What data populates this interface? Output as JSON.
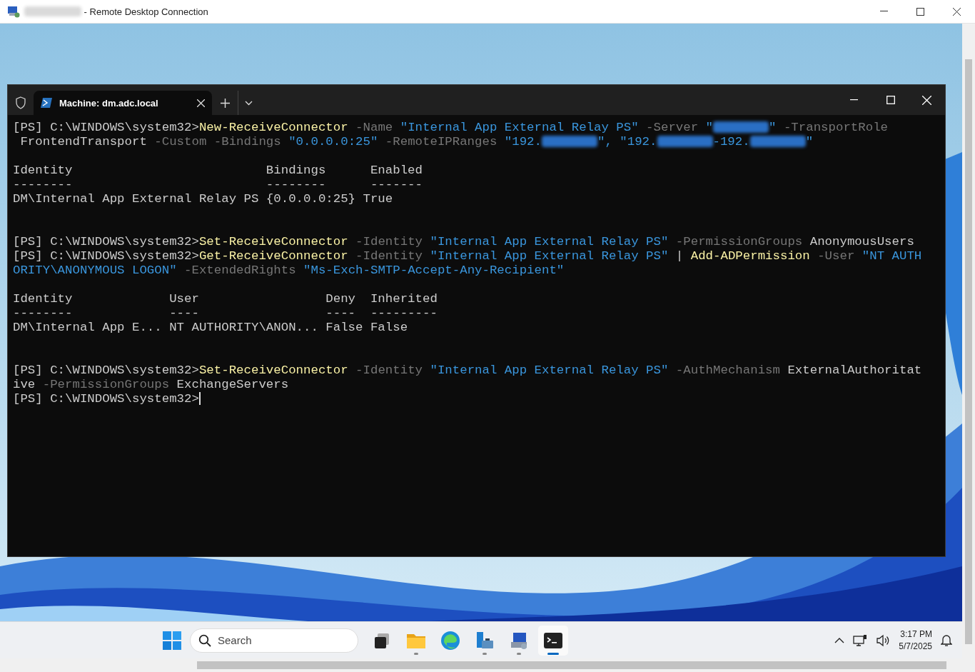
{
  "rdp_window": {
    "host": {
      "kind": "redacted"
    },
    "title": " - Remote Desktop Connection"
  },
  "terminal": {
    "tab": {
      "title": "Machine: dm.adc.local",
      "selected": true
    },
    "lines": [
      {
        "kind": "text",
        "tokens": [
          {
            "kind": "prompt",
            "text": "[PS] C:\\WINDOWS\\system32>"
          },
          {
            "kind": "cmd",
            "text": "New-ReceiveConnector"
          },
          {
            "kind": "param",
            "text": " -Name "
          },
          {
            "kind": "string",
            "text": "\"Internal App External Relay PS\""
          },
          {
            "kind": "param",
            "text": " -Server "
          },
          {
            "kind": "string",
            "text": "\""
          },
          {
            "kind": "redacted"
          },
          {
            "kind": "string",
            "text": "\""
          },
          {
            "kind": "param",
            "text": " -TransportRole"
          }
        ]
      },
      {
        "kind": "text",
        "tokens": [
          {
            "kind": "plain",
            "text": " FrontendTransport"
          },
          {
            "kind": "param",
            "text": " -Custom -Bindings "
          },
          {
            "kind": "string",
            "text": "\"0.0.0.0:25\""
          },
          {
            "kind": "param",
            "text": " -RemoteIPRanges "
          },
          {
            "kind": "string",
            "text": "\"192."
          },
          {
            "kind": "redacted"
          },
          {
            "kind": "string",
            "text": "\", \"192."
          },
          {
            "kind": "redacted"
          },
          {
            "kind": "string",
            "text": "-192."
          },
          {
            "kind": "redacted"
          },
          {
            "kind": "string",
            "text": "\""
          }
        ]
      },
      {
        "kind": "blank"
      },
      {
        "kind": "text",
        "tokens": [
          {
            "kind": "plain",
            "text": "Identity                          Bindings      Enabled"
          }
        ]
      },
      {
        "kind": "text",
        "tokens": [
          {
            "kind": "plain",
            "text": "--------                          --------      -------"
          }
        ]
      },
      {
        "kind": "text",
        "tokens": [
          {
            "kind": "plain",
            "text": "DM\\Internal App External Relay PS {0.0.0.0:25} True"
          }
        ]
      },
      {
        "kind": "blank"
      },
      {
        "kind": "blank"
      },
      {
        "kind": "text",
        "tokens": [
          {
            "kind": "prompt",
            "text": "[PS] C:\\WINDOWS\\system32>"
          },
          {
            "kind": "cmd",
            "text": "Set-ReceiveConnector"
          },
          {
            "kind": "param",
            "text": " -Identity "
          },
          {
            "kind": "string",
            "text": "\"Internal App External Relay PS\""
          },
          {
            "kind": "param",
            "text": " -PermissionGroups "
          },
          {
            "kind": "plain",
            "text": "AnonymousUsers"
          }
        ]
      },
      {
        "kind": "text",
        "tokens": [
          {
            "kind": "prompt",
            "text": "[PS] C:\\WINDOWS\\system32>"
          },
          {
            "kind": "cmd",
            "text": "Get-ReceiveConnector"
          },
          {
            "kind": "param",
            "text": " -Identity "
          },
          {
            "kind": "string",
            "text": "\"Internal App External Relay PS\""
          },
          {
            "kind": "plain",
            "text": " | "
          },
          {
            "kind": "cmd",
            "text": "Add-ADPermission"
          },
          {
            "kind": "param",
            "text": " -User "
          },
          {
            "kind": "string",
            "text": "\"NT AUTH"
          }
        ]
      },
      {
        "kind": "text",
        "tokens": [
          {
            "kind": "string",
            "text": "ORITY\\ANONYMOUS LOGON\""
          },
          {
            "kind": "param",
            "text": " -ExtendedRights "
          },
          {
            "kind": "string",
            "text": "\"Ms-Exch-SMTP-Accept-Any-Recipient\""
          }
        ]
      },
      {
        "kind": "blank"
      },
      {
        "kind": "text",
        "tokens": [
          {
            "kind": "plain",
            "text": "Identity             User                 Deny  Inherited"
          }
        ]
      },
      {
        "kind": "text",
        "tokens": [
          {
            "kind": "plain",
            "text": "--------             ----                 ----  ---------"
          }
        ]
      },
      {
        "kind": "text",
        "tokens": [
          {
            "kind": "plain",
            "text": "DM\\Internal App E... NT AUTHORITY\\ANON... False False"
          }
        ]
      },
      {
        "kind": "blank"
      },
      {
        "kind": "blank"
      },
      {
        "kind": "text",
        "tokens": [
          {
            "kind": "prompt",
            "text": "[PS] C:\\WINDOWS\\system32>"
          },
          {
            "kind": "cmd",
            "text": "Set-ReceiveConnector"
          },
          {
            "kind": "param",
            "text": " -Identity "
          },
          {
            "kind": "string",
            "text": "\"Internal App External Relay PS\""
          },
          {
            "kind": "param",
            "text": " -AuthMechanism "
          },
          {
            "kind": "plain",
            "text": "ExternalAuthoritat"
          }
        ]
      },
      {
        "kind": "text",
        "tokens": [
          {
            "kind": "plain",
            "text": "ive"
          },
          {
            "kind": "param",
            "text": " -PermissionGroups "
          },
          {
            "kind": "plain",
            "text": "ExchangeServers"
          }
        ]
      },
      {
        "kind": "text",
        "tokens": [
          {
            "kind": "prompt",
            "text": "[PS] C:\\WINDOWS\\system32>"
          },
          {
            "kind": "cursor"
          }
        ]
      }
    ]
  },
  "taskbar": {
    "search": {
      "placeholder": "Search"
    },
    "apps": [
      {
        "kind": "taskview",
        "running": false,
        "selected": false
      },
      {
        "kind": "explorer",
        "running": true,
        "selected": false
      },
      {
        "kind": "edge",
        "running": false,
        "selected": false
      },
      {
        "kind": "server",
        "running": true,
        "selected": false
      },
      {
        "kind": "rdp",
        "running": true,
        "selected": false
      },
      {
        "kind": "terminal",
        "running": true,
        "selected": true
      }
    ],
    "time": "3:17 PM",
    "date": "5/7/2025"
  }
}
